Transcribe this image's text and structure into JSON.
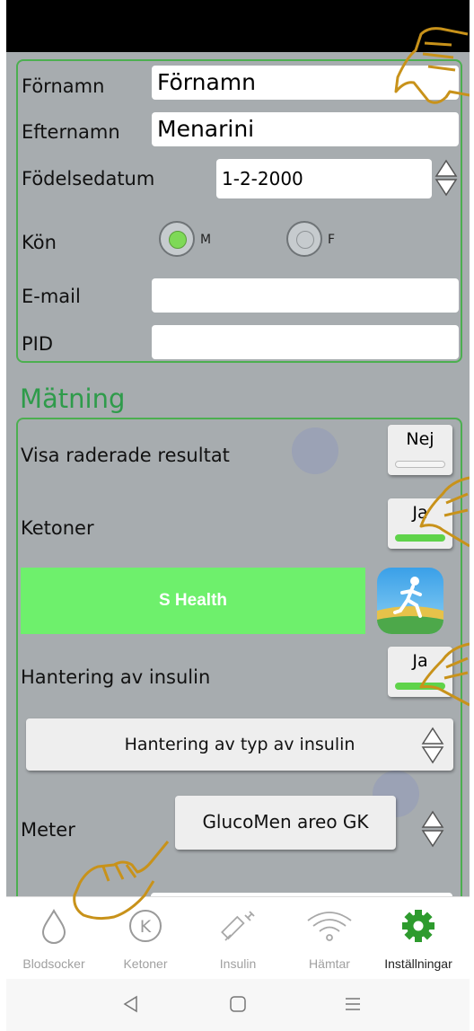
{
  "form": {
    "first_name_label": "Förnamn",
    "first_name_value": "Förnamn",
    "last_name_label": "Efternamn",
    "last_name_value": "Menarini",
    "dob_label": "Födelsedatum",
    "dob_value": "1-2-2000",
    "gender_label": "Kön",
    "gender_male": "M",
    "gender_female": "F",
    "gender_selected": "M",
    "email_label": "E-mail",
    "email_value": "",
    "pid_label": "PID",
    "pid_value": ""
  },
  "measurement": {
    "section_title": "Mätning",
    "show_deleted_label": "Visa raderade resultat",
    "show_deleted_value": "Nej",
    "ketones_label": "Ketoner",
    "ketones_value": "Ja",
    "shealth_label": "S Health",
    "insulin_label": "Hantering av insulin",
    "insulin_value": "Ja",
    "insulin_type_label": "Hantering av typ av insulin",
    "meter_label": "Meter",
    "meter_value": "GlucoMen areo GK"
  },
  "nav": {
    "items": [
      {
        "label": "Blodsocker",
        "icon": "drop-icon"
      },
      {
        "label": "Ketoner",
        "icon": "k-circle-icon"
      },
      {
        "label": "Insulin",
        "icon": "syringe-icon"
      },
      {
        "label": "Hämtar",
        "icon": "wifi-icon"
      },
      {
        "label": "Inställningar",
        "icon": "gear-icon"
      }
    ],
    "active": "Inställningar"
  },
  "colors": {
    "accent_green": "#4caf50",
    "toggle_on": "#5fd34a",
    "shealth_green": "#6ef06c",
    "content_bg": "#a7acaf",
    "gear_green": "#2e9b2e"
  }
}
